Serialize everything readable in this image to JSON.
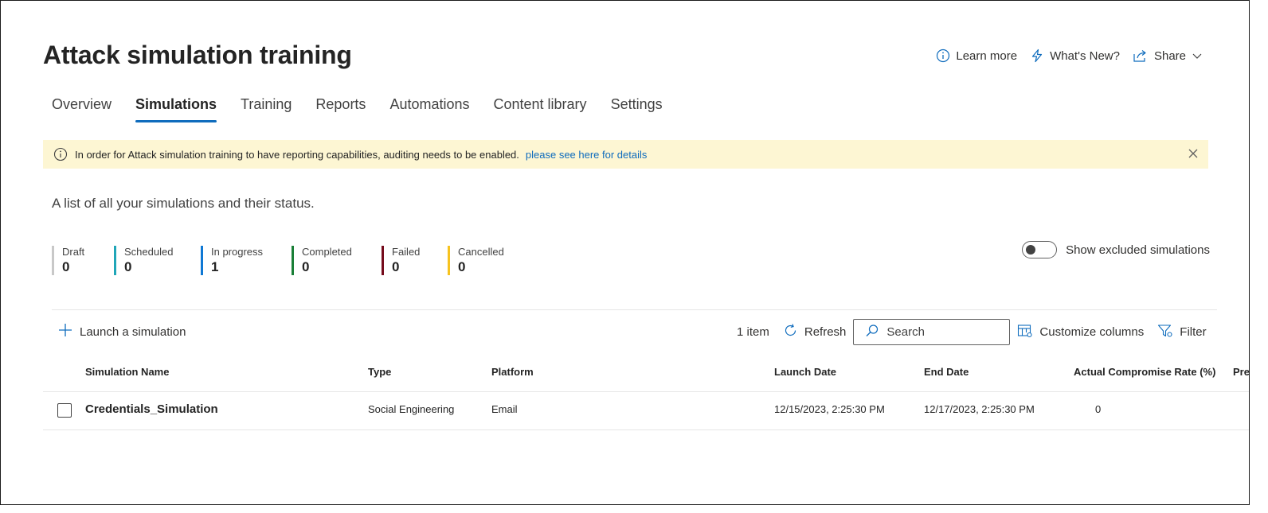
{
  "header": {
    "title": "Attack simulation training",
    "learn_more": "Learn more",
    "whats_new": "What's New?",
    "share": "Share"
  },
  "tabs": [
    {
      "label": "Overview",
      "active": false
    },
    {
      "label": "Simulations",
      "active": true
    },
    {
      "label": "Training",
      "active": false
    },
    {
      "label": "Reports",
      "active": false
    },
    {
      "label": "Automations",
      "active": false
    },
    {
      "label": "Content library",
      "active": false
    },
    {
      "label": "Settings",
      "active": false
    }
  ],
  "banner": {
    "message": "In order for Attack simulation training to have reporting capabilities, auditing needs to be enabled.",
    "link": "please see here for details"
  },
  "subtitle": "A list of all your simulations and their status.",
  "status": [
    {
      "label": "Draft",
      "count": "0",
      "color": "#c8c8c8"
    },
    {
      "label": "Scheduled",
      "count": "0",
      "color": "#20a6b8"
    },
    {
      "label": "In progress",
      "count": "1",
      "color": "#0f78d4"
    },
    {
      "label": "Completed",
      "count": "0",
      "color": "#1a7f37"
    },
    {
      "label": "Failed",
      "count": "0",
      "color": "#750b1c"
    },
    {
      "label": "Cancelled",
      "count": "0",
      "color": "#f7c31f"
    }
  ],
  "toggle": {
    "label": "Show excluded simulations",
    "on": false
  },
  "toolbar": {
    "launch": "Launch a simulation",
    "item_count": "1 item",
    "refresh": "Refresh",
    "search_placeholder": "Search",
    "customize": "Customize columns",
    "filter": "Filter"
  },
  "table": {
    "columns": [
      "Simulation Name",
      "Type",
      "Platform",
      "Launch Date",
      "End Date",
      "Actual Compromise Rate (%)",
      "Pre"
    ],
    "rows": [
      {
        "name": "Credentials_Simulation",
        "type": "Social Engineering",
        "platform": "Email",
        "launch_date": "12/15/2023, 2:25:30 PM",
        "end_date": "12/17/2023, 2:25:30 PM",
        "compromise_rate": "0"
      }
    ]
  },
  "colors": {
    "accent": "#0f6cbd",
    "banner_bg": "#fdf6d3"
  }
}
